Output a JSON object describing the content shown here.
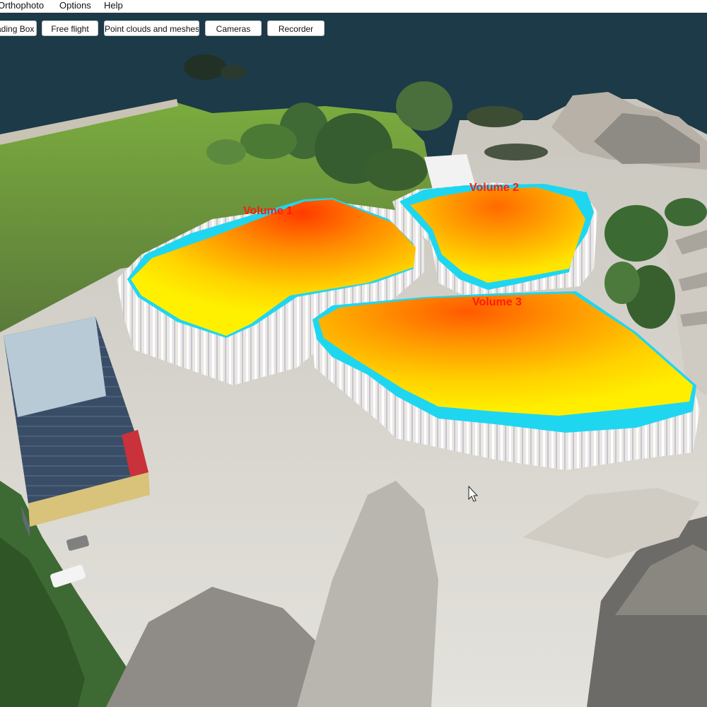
{
  "menu": {
    "items": [
      {
        "label": "Orthophoto"
      },
      {
        "label": "Options"
      },
      {
        "label": "Help"
      }
    ]
  },
  "toolbar": {
    "buttons": [
      {
        "label": "ading Box c"
      },
      {
        "label": "Free flight"
      },
      {
        "label": "Point clouds and meshes"
      },
      {
        "label": "Cameras"
      },
      {
        "label": "Recorder"
      }
    ]
  },
  "scene": {
    "volumes": [
      {
        "label": "Volume 1"
      },
      {
        "label": "Volume 2"
      },
      {
        "label": "Volume 3"
      }
    ],
    "colors": {
      "water": "#1d3a48",
      "grass": "#6f9a3c",
      "ground": "#d9d6cf",
      "volume_high": "#ff4a00",
      "volume_mid": "#ff9a00",
      "volume_low": "#ffe600",
      "volume_base": "#1fd6f0",
      "label": "#ff1a0a"
    }
  }
}
